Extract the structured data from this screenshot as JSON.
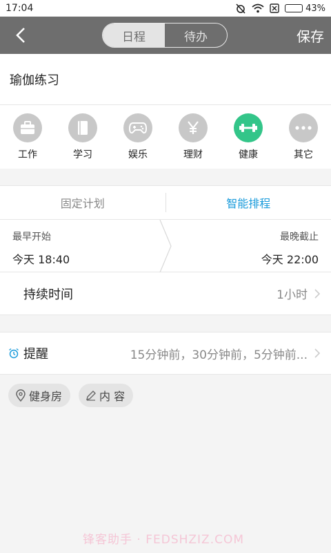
{
  "status_bar": {
    "time": "17:04",
    "battery": "43%",
    "battery_level": 0.43
  },
  "app_bar": {
    "tabs": [
      {
        "label": "日程",
        "active": true
      },
      {
        "label": "待办",
        "active": false
      }
    ],
    "save_label": "保存",
    "background": "#6e6e6e"
  },
  "event": {
    "title": "瑜伽练习"
  },
  "categories": [
    {
      "label": "工作",
      "icon": "briefcase-icon"
    },
    {
      "label": "学习",
      "icon": "book-icon"
    },
    {
      "label": "娱乐",
      "icon": "gamepad-icon"
    },
    {
      "label": "理财",
      "icon": "yen-icon"
    },
    {
      "label": "健康",
      "icon": "dumbbell-icon",
      "selected": true,
      "color": "#33c589"
    },
    {
      "label": "其它",
      "icon": "more-icon"
    }
  ],
  "schedule_modes": [
    {
      "label": "固定计划",
      "active": false
    },
    {
      "label": "智能排程",
      "active": true,
      "color": "#1a9bdb"
    }
  ],
  "time_range": {
    "earliest_start_caption": "最早开始",
    "earliest_start_value": "今天  18:40",
    "latest_end_caption": "最晚截止",
    "latest_end_value": "今天  22:00"
  },
  "duration": {
    "label": "持续时间",
    "value": "1小时"
  },
  "reminder": {
    "label": "提醒",
    "value": "15分钟前，30分钟前，5分钟前..."
  },
  "chips": [
    {
      "label": "健身房",
      "icon": "location-pin-icon"
    },
    {
      "label": "内 容",
      "icon": "pencil-icon"
    }
  ],
  "watermark": "锋客助手 · FEDSHZIZ.COM"
}
